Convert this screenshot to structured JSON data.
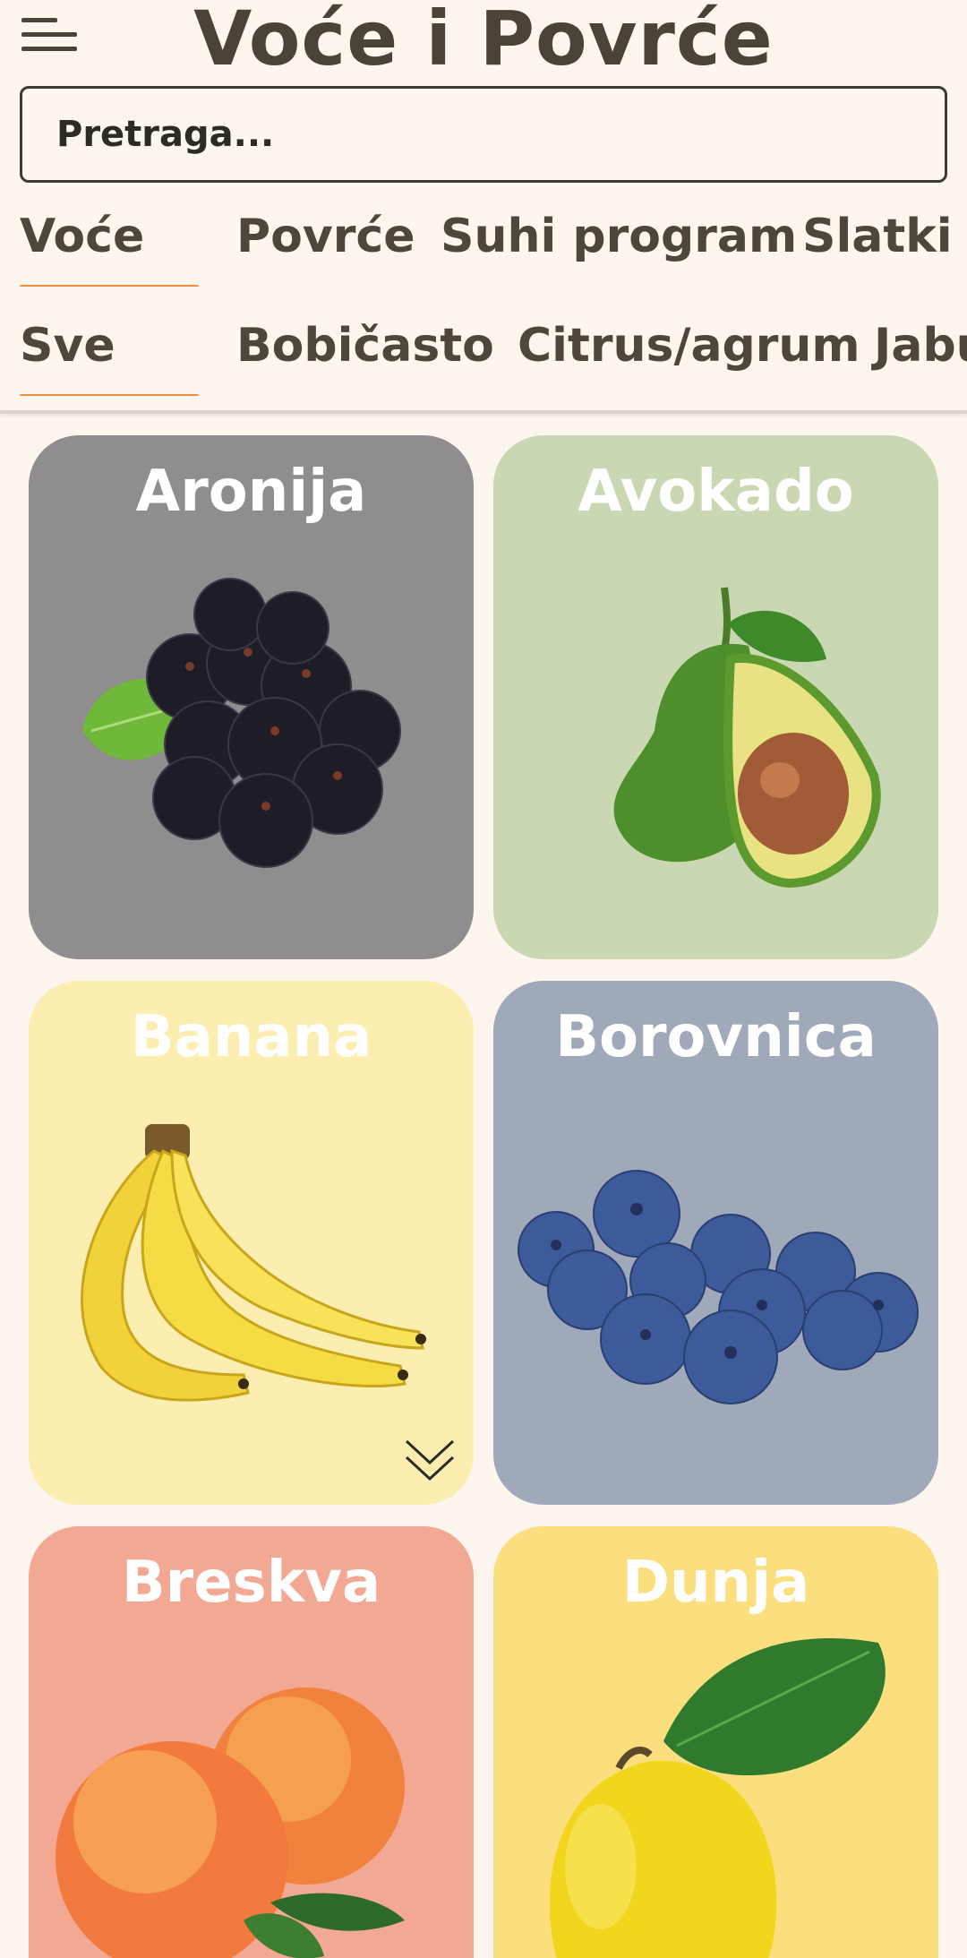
{
  "header": {
    "title": "Voće i Povrće"
  },
  "search": {
    "placeholder": "Pretraga..."
  },
  "categories": [
    {
      "label": "Voće",
      "active": true
    },
    {
      "label": "Povrće",
      "active": false
    },
    {
      "label": "Suhi program",
      "active": false
    },
    {
      "label": "Slatki p",
      "active": false
    }
  ],
  "subcategories": [
    {
      "label": "Sve",
      "active": true
    },
    {
      "label": "Bobičasto",
      "active": false
    },
    {
      "label": "Citrus/agrum",
      "active": false
    },
    {
      "label": "Jabu",
      "active": false
    }
  ],
  "cards": [
    {
      "name": "Aronija",
      "bg": "#8f8d8d",
      "icon": "aronia-berries"
    },
    {
      "name": "Avokado",
      "bg": "#c9d8b3",
      "icon": "avocado"
    },
    {
      "name": "Banana",
      "bg": "#fbeeb0",
      "icon": "banana-bunch"
    },
    {
      "name": "Borovnica",
      "bg": "#a0a9b9",
      "icon": "blueberries"
    },
    {
      "name": "Breskva",
      "bg": "#f3a893",
      "icon": "peaches"
    },
    {
      "name": "Dunja",
      "bg": "#fbdf7e",
      "icon": "quince"
    }
  ],
  "colors": {
    "accent": "#f0913a",
    "background": "#fdf6ee",
    "text": "#4a4438"
  }
}
